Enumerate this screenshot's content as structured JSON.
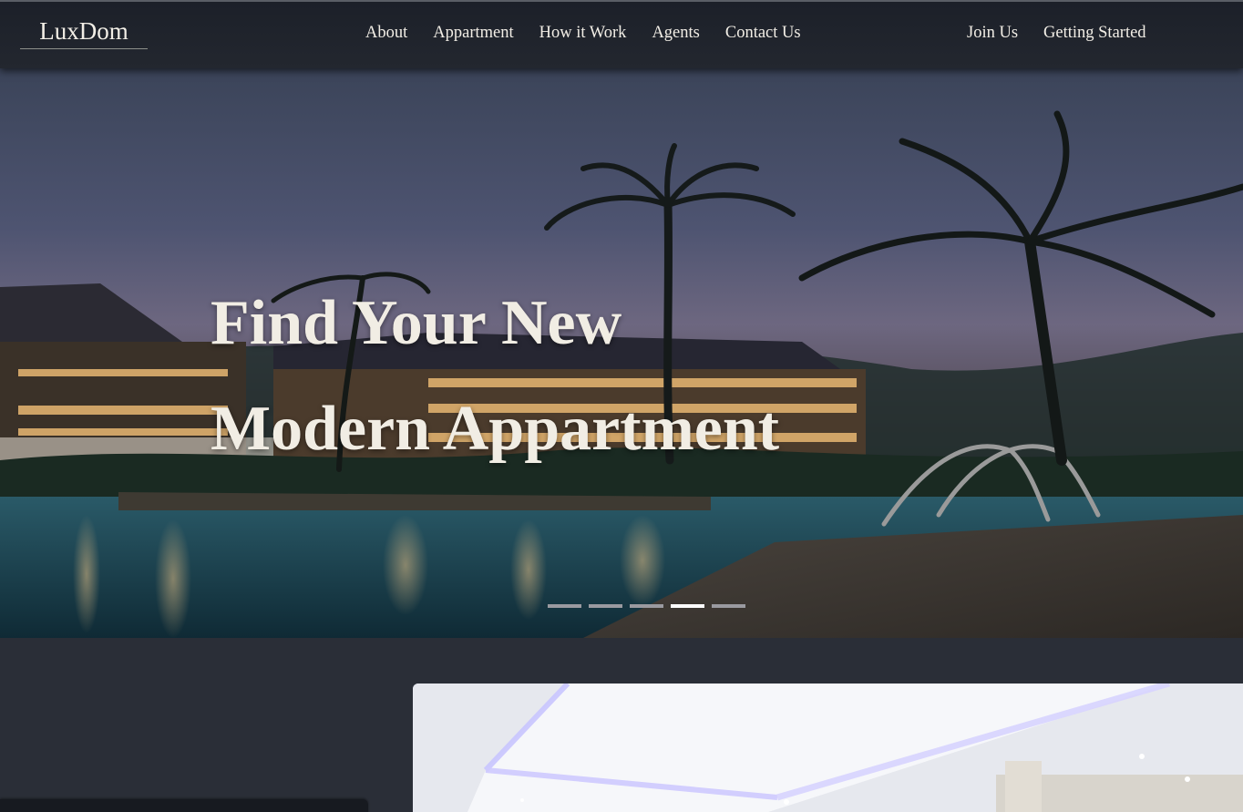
{
  "brand": {
    "logo": "LuxDom"
  },
  "nav": {
    "links": [
      "About",
      "Appartment",
      "How it Work",
      "Agents",
      "Contact Us"
    ],
    "right": [
      "Join Us",
      "Getting Started"
    ]
  },
  "hero": {
    "title_line1": "Find Your New",
    "title_line2": "Modern Appartment",
    "slides_total": 5,
    "active_slide": 4
  },
  "colors": {
    "nav_bg": "#1f232b",
    "page_bg": "#2a2e37",
    "text": "#f2eee6",
    "dot_active": "#ffffff",
    "dot_inactive": "#9a9aa0"
  }
}
